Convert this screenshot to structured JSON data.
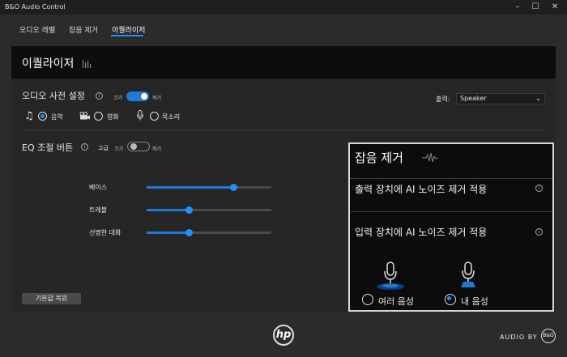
{
  "window": {
    "title": "B&O Audio Control",
    "minimize_glyph": "–",
    "maximize_glyph": "☐",
    "close_glyph": "✕"
  },
  "tabs": [
    {
      "label": "오디오 레벨"
    },
    {
      "label": "잡음 제거"
    },
    {
      "label": "이퀄라이저"
    }
  ],
  "active_tab": 2,
  "panel": {
    "title": "이퀄라이저"
  },
  "audio_preset": {
    "label": "오디오 사전 설정",
    "toggle_off_label": "끄기",
    "toggle_on_label": "켜기",
    "toggle_state": "on",
    "options": [
      {
        "label": "음악",
        "icon": "music-note-icon",
        "selected": true
      },
      {
        "label": "영화",
        "icon": "video-camera-icon",
        "selected": false
      },
      {
        "label": "목소리",
        "icon": "microphone-icon",
        "selected": false
      }
    ]
  },
  "output": {
    "label": "출력:",
    "selected": "Speaker"
  },
  "eq": {
    "label": "EQ 조절 버튼",
    "advanced_label": "고급",
    "toggle_off_label": "끄기",
    "toggle_on_label": "켜기",
    "toggle_state": "off",
    "sliders": [
      {
        "label": "베이스",
        "value": 0.7
      },
      {
        "label": "트레블",
        "value": 0.34
      },
      {
        "label": "선명한 대화",
        "value": 0.34
      }
    ],
    "reset_label": "기본값 복원"
  },
  "noise_reduction": {
    "title": "잡음 제거",
    "output_ai_label": "출력 장치에 AI 노이즈 제거 적용",
    "input_ai_label": "입력 장치에 AI 노이즈 제거 적용",
    "mic_options": [
      {
        "label": "여러 음성",
        "selected": false
      },
      {
        "label": "내 음성",
        "selected": true
      }
    ]
  },
  "footer": {
    "hp_logo": "hp",
    "audio_by": "AUDIO BY",
    "bo_badge": "B&O"
  },
  "colors": {
    "accent": "#1e90ff",
    "background": "#2b2b2b",
    "panel": "#262626",
    "header": "#0d0d0d"
  }
}
